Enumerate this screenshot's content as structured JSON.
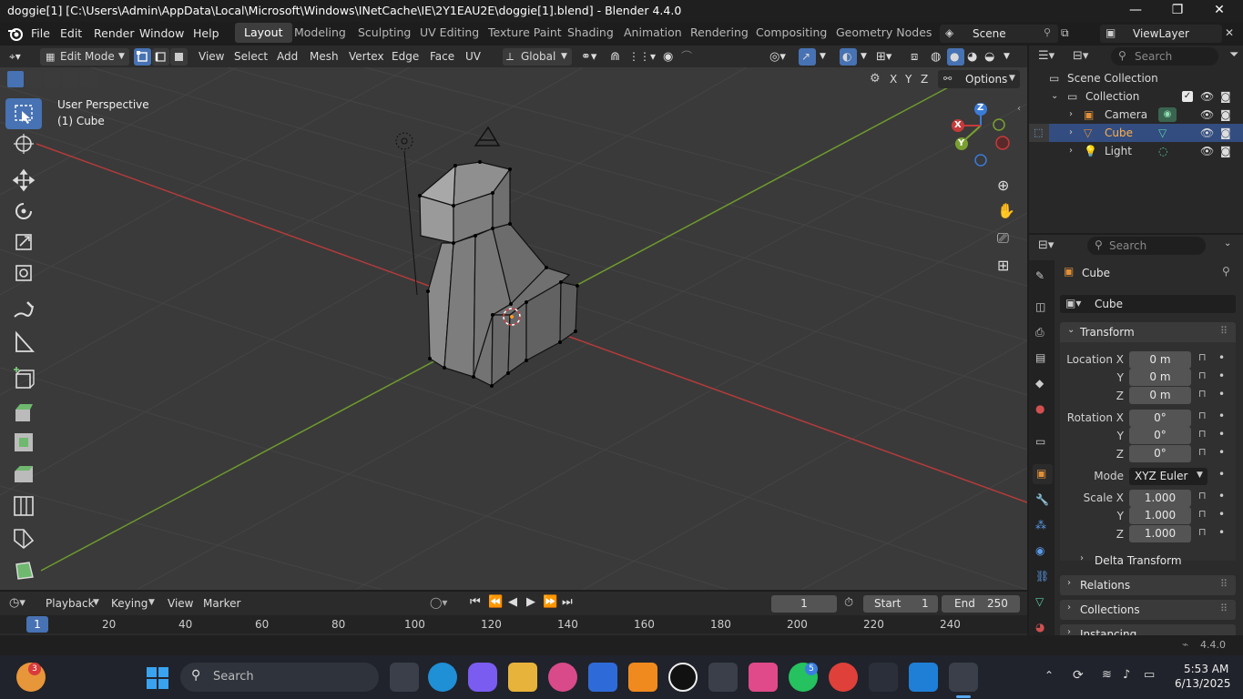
{
  "window": {
    "title": "doggie[1] [C:\\Users\\Admin\\AppData\\Local\\Microsoft\\Windows\\INetCache\\IE\\2Y1EAU2E\\doggie[1].blend] - Blender 4.4.0",
    "minimize": "—",
    "maximize": "❐",
    "close": "✕"
  },
  "menubar": {
    "items": [
      "File",
      "Edit",
      "Render",
      "Window",
      "Help"
    ],
    "workspaces": [
      "Layout",
      "Modeling",
      "Sculpting",
      "UV Editing",
      "Texture Paint",
      "Shading",
      "Animation",
      "Rendering",
      "Compositing",
      "Geometry Nodes"
    ],
    "active_workspace": "Layout",
    "scene": "Scene",
    "view_layer": "ViewLayer"
  },
  "header3d": {
    "mode": "Edit Mode",
    "menus": [
      "View",
      "Select",
      "Add",
      "Mesh",
      "Vertex",
      "Edge",
      "Face",
      "UV"
    ],
    "orientation": "Global",
    "axes": [
      "X",
      "Y",
      "Z"
    ],
    "options": "Options"
  },
  "viewport": {
    "perspective": "User Perspective",
    "object": "(1) Cube",
    "gizmo": {
      "x": "X",
      "y": "Y",
      "z": "Z"
    },
    "colors": {
      "x_axis": "#c63a3a",
      "y_axis": "#7aa030",
      "z_axis": "#3b7bd8",
      "bg": "#3a3a3a"
    }
  },
  "outliner": {
    "search_placeholder": "Search",
    "root": "Scene Collection",
    "collection": "Collection",
    "items": [
      {
        "name": "Camera",
        "icon": "camera-icon",
        "selected": false
      },
      {
        "name": "Cube",
        "icon": "mesh-icon",
        "selected": true
      },
      {
        "name": "Light",
        "icon": "light-icon",
        "selected": false
      }
    ]
  },
  "properties": {
    "search_placeholder": "Search",
    "object_name": "Cube",
    "data_name": "Cube",
    "panel_transform": "Transform",
    "location_label": "Location X",
    "rotation_label": "Rotation X",
    "scale_label": "Scale X",
    "y_label": "Y",
    "z_label": "Z",
    "location": [
      "0 m",
      "0 m",
      "0 m"
    ],
    "rotation": [
      "0°",
      "0°",
      "0°"
    ],
    "mode_label": "Mode",
    "mode_value": "XYZ Euler",
    "scale": [
      "1.000",
      "1.000",
      "1.000"
    ],
    "delta_transform": "Delta Transform",
    "relations": "Relations",
    "collections": "Collections",
    "instancing": "Instancing"
  },
  "timeline": {
    "menus": [
      "Playback",
      "Keying",
      "View",
      "Marker"
    ],
    "current_frame": "1",
    "start_label": "Start",
    "start_value": "1",
    "end_label": "End",
    "end_value": "250",
    "ruler": [
      "1",
      "20",
      "40",
      "60",
      "80",
      "100",
      "120",
      "140",
      "160",
      "180",
      "200",
      "220",
      "240"
    ]
  },
  "status": {
    "version": "4.4.0"
  },
  "taskbar": {
    "search_placeholder": "Search",
    "weather_badge": "3",
    "whatsapp_badge": "5",
    "time": "5:53 AM",
    "date": "6/13/2025"
  }
}
